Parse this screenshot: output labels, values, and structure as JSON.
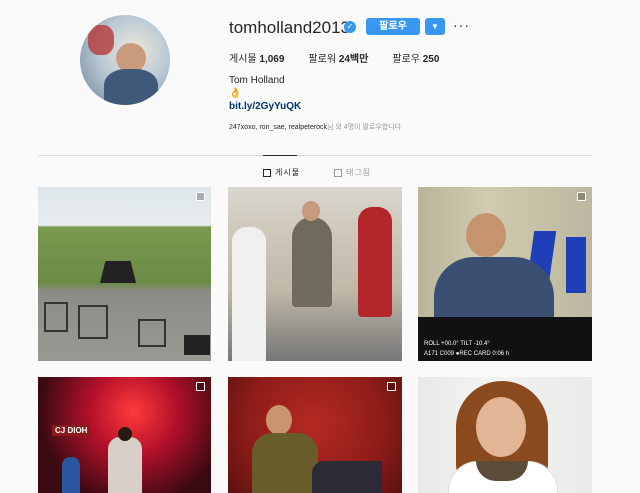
{
  "profile": {
    "username": "tomholland2013",
    "follow_label": "팔로우",
    "stats": {
      "posts_label": "게시물",
      "posts_value": "1,069",
      "followers_label": "팔로워",
      "followers_value": "24백만",
      "following_label": "팔로우",
      "following_value": "250"
    },
    "full_name": "Tom Holland",
    "emoji": "👌",
    "link": "bit.ly/2GyYuQK",
    "followed_by_names": "247xoxo, ron_sae, realpeterock",
    "followed_by_suffix": "님 외 4명이 팔로우합니다"
  },
  "tabs": [
    {
      "label": "게시물",
      "active": true
    },
    {
      "label": "태그됨",
      "active": false
    }
  ],
  "tile_overlays": {
    "t3_text_line1": "ROLL +00.0°   TILT -10.4°",
    "t3_text_line2": "A171 C009  ●REC  CARD  0:06 h",
    "t4_sign": "CJ DIOH",
    "t5_badge": ""
  },
  "colors": {
    "accent": "#3897f0",
    "text": "#262626",
    "muted": "#999999",
    "link": "#003569",
    "background": "#fafafa"
  }
}
